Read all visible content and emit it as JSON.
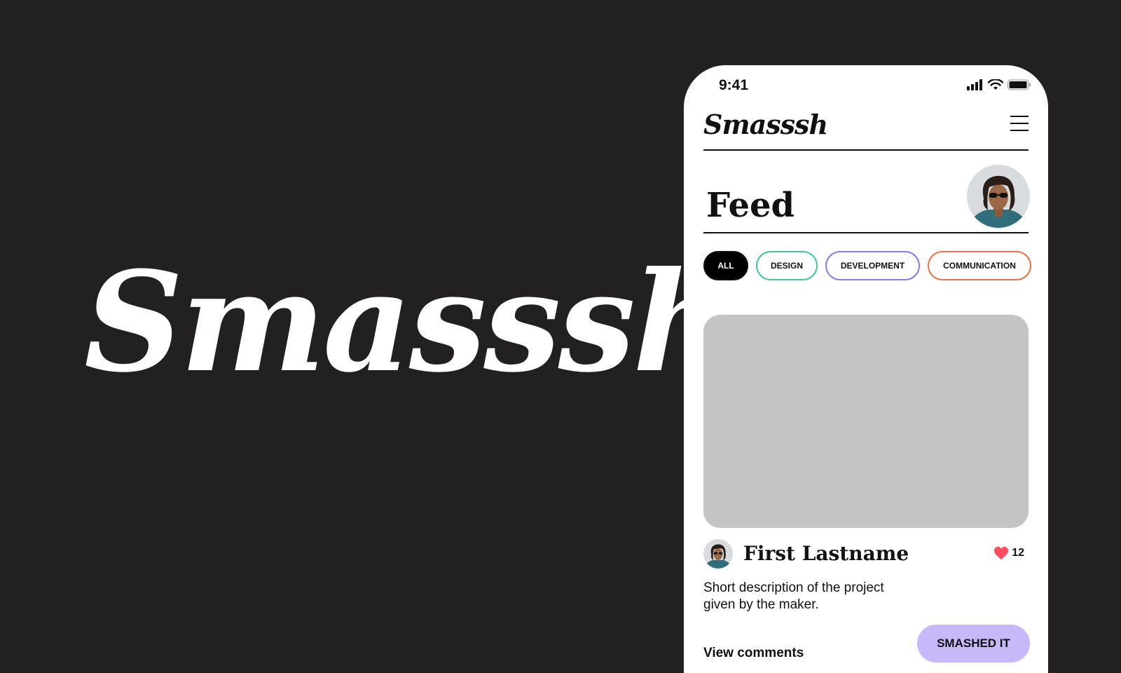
{
  "hero": {
    "logo_text": "Smasssh"
  },
  "status_bar": {
    "time": "9:41",
    "icons": [
      "cellular-signal-icon",
      "wifi-icon",
      "battery-icon"
    ]
  },
  "app_bar": {
    "logo_text": "Smasssh",
    "menu_icon": "hamburger-menu-icon"
  },
  "feed": {
    "title": "Feed",
    "profile_avatar": "user-avatar",
    "filters": [
      {
        "label": "ALL",
        "selected": true,
        "color": "#000000"
      },
      {
        "label": "DESIGN",
        "selected": false,
        "color": "#3cc89a"
      },
      {
        "label": "DEVELOPMENT",
        "selected": false,
        "color": "#8a76f0"
      },
      {
        "label": "COMMUNICATION",
        "selected": false,
        "color": "#f2703f"
      }
    ]
  },
  "post": {
    "author": "First Lastname",
    "likes": "12",
    "like_icon": "heart-icon",
    "description": "Short description of the project given by the maker.",
    "view_comments_label": "View comments",
    "smash_button_label": "SMASHED IT"
  },
  "colors": {
    "background": "#222021",
    "accent_purple": "#c8b8fa",
    "heart": "#ff4d5e",
    "image_placeholder": "#c4c4c4"
  }
}
